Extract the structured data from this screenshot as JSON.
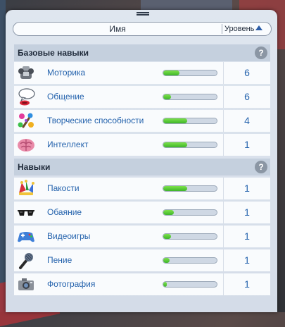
{
  "header": {
    "name_label": "Имя",
    "level_label": "Уровень"
  },
  "sections": [
    {
      "title": "Базовые навыки",
      "help": "?",
      "items": [
        {
          "label": "Моторика",
          "level": "6",
          "progress": 0.3,
          "icon": "motor-icon"
        },
        {
          "label": "Общение",
          "level": "6",
          "progress": 0.15,
          "icon": "social-icon"
        },
        {
          "label": "Творческие способности",
          "level": "4",
          "progress": 0.45,
          "icon": "creativity-icon"
        },
        {
          "label": "Интеллект",
          "level": "1",
          "progress": 0.45,
          "icon": "brain-icon"
        }
      ]
    },
    {
      "title": "Навыки",
      "help": "?",
      "items": [
        {
          "label": "Пакости",
          "level": "1",
          "progress": 0.45,
          "icon": "jester-hat-icon"
        },
        {
          "label": "Обаяние",
          "level": "1",
          "progress": 0.2,
          "icon": "sunglasses-icon"
        },
        {
          "label": "Видеоигры",
          "level": "1",
          "progress": 0.15,
          "icon": "gamepad-icon"
        },
        {
          "label": "Пение",
          "level": "1",
          "progress": 0.12,
          "icon": "microphone-icon"
        },
        {
          "label": "Фотография",
          "level": "1",
          "progress": 0.02,
          "icon": "camera-icon"
        }
      ]
    }
  ]
}
